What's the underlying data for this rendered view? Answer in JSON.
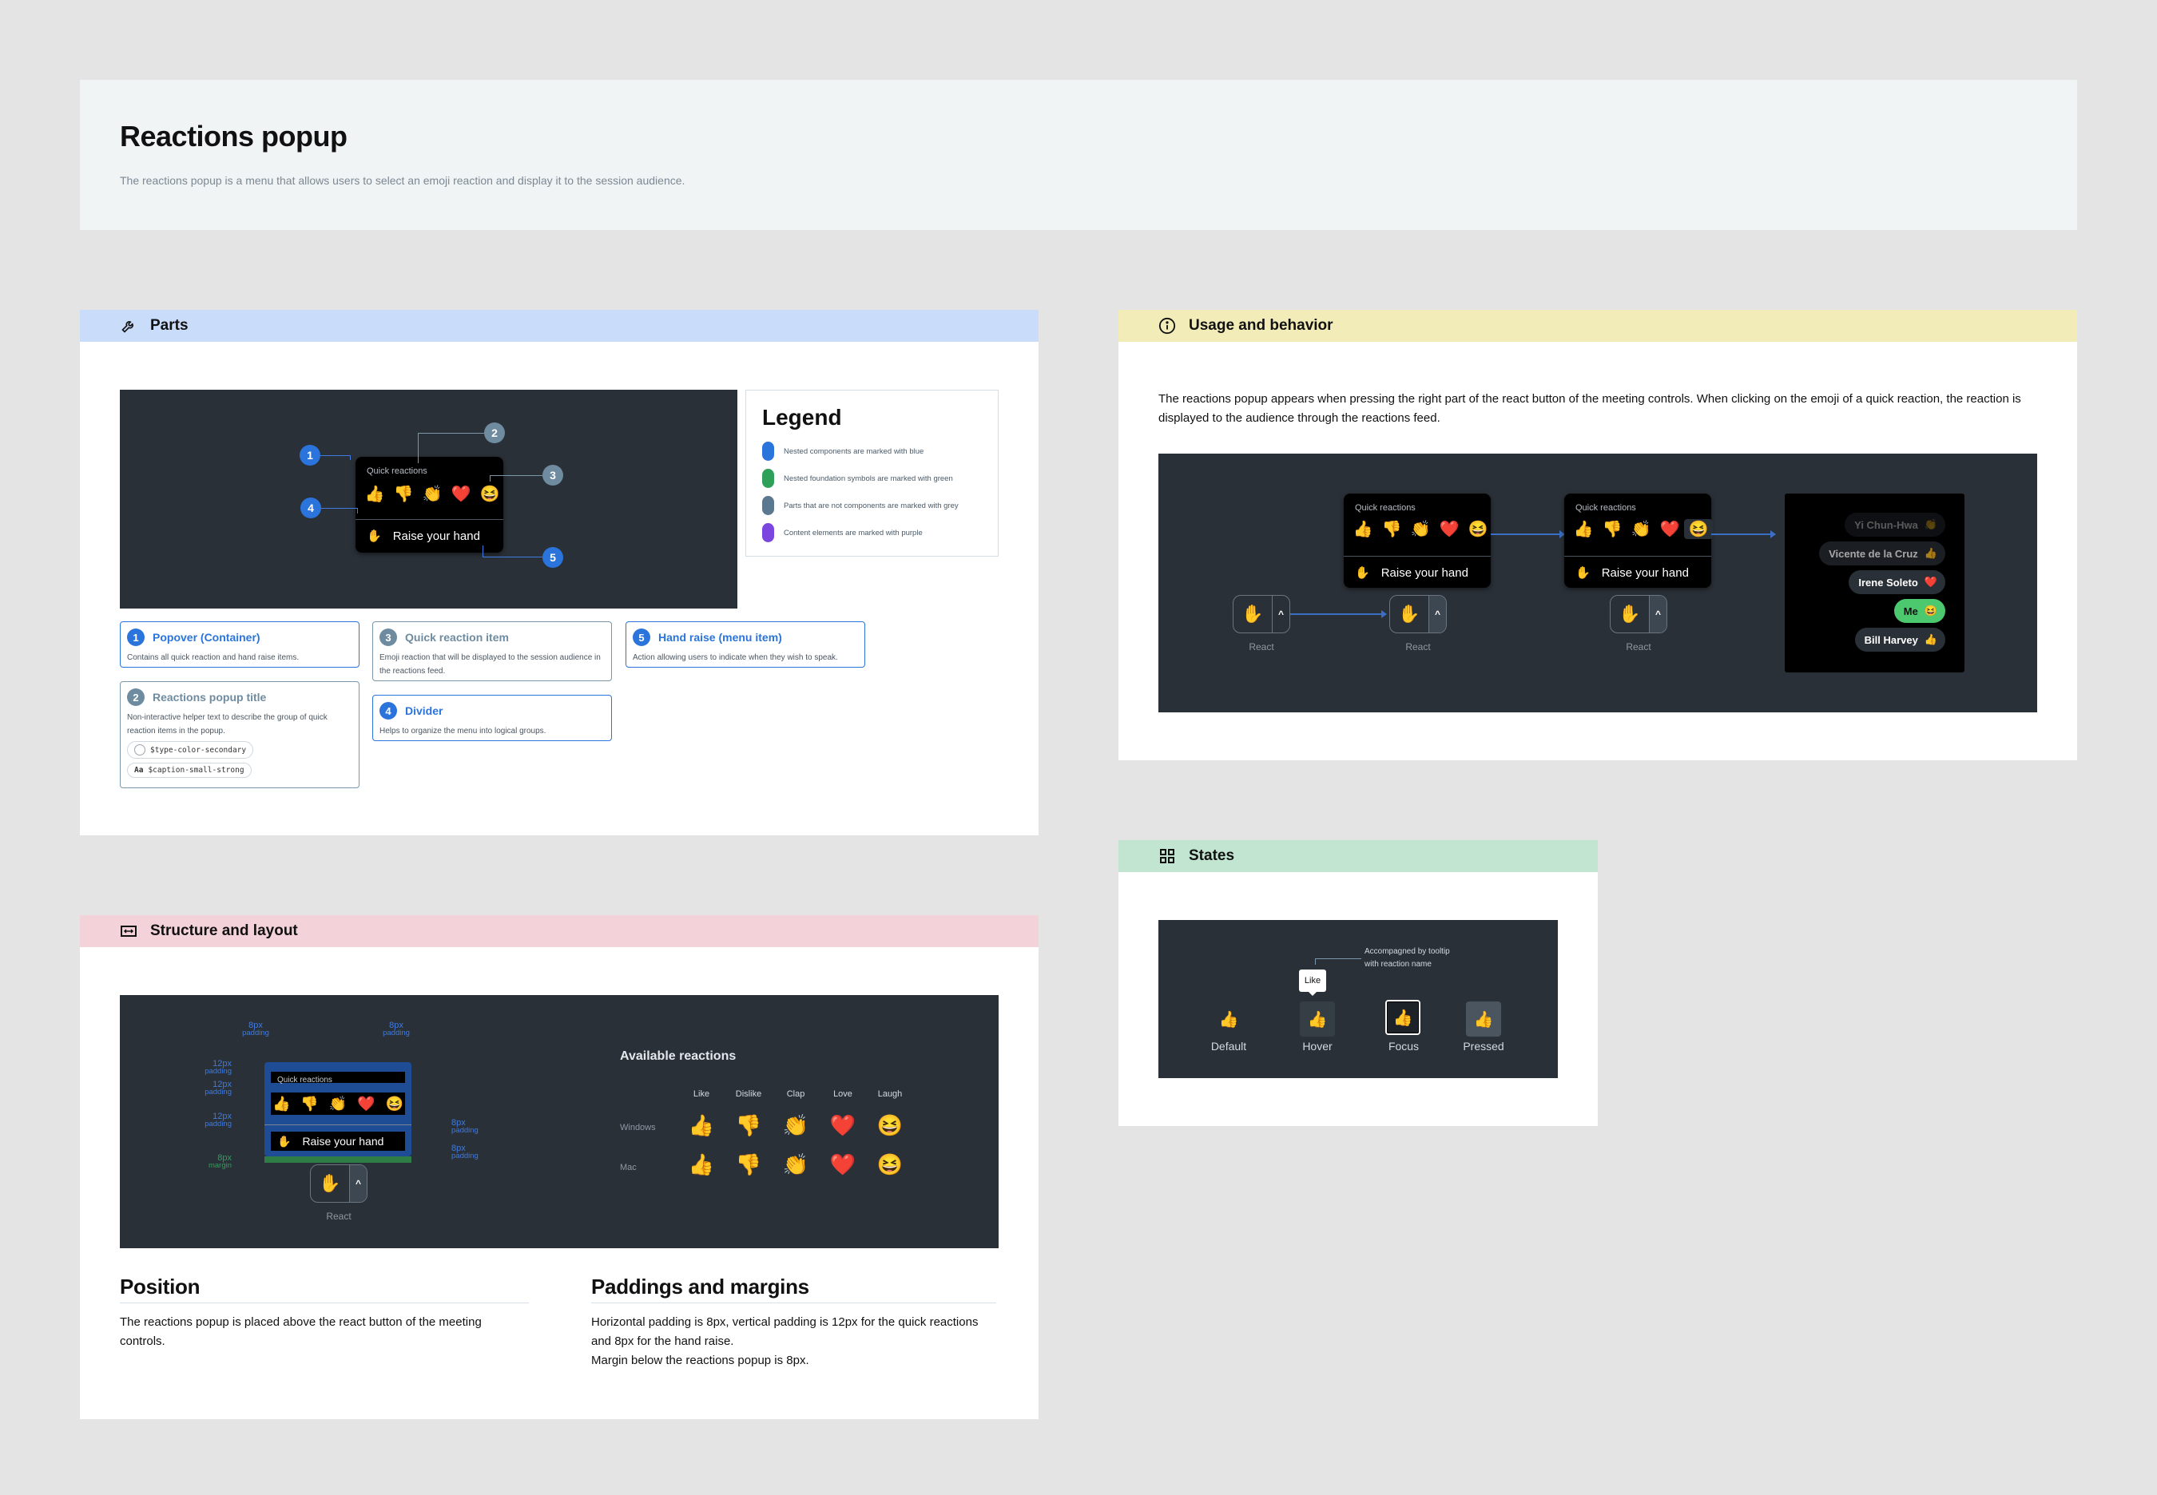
{
  "header": {
    "title": "Reactions popup",
    "subtitle": "The reactions popup is a menu that allows users to select an emoji reaction and display it to the session audience."
  },
  "parts": {
    "section_title": "Parts",
    "section_icon": "wrench-icon",
    "popup": {
      "title": "Quick reactions",
      "emojis": [
        "👍",
        "👎",
        "👏",
        "❤️",
        "😆"
      ],
      "hand_label": "Raise your hand",
      "hand_icon": "✋"
    },
    "badges": [
      "1",
      "2",
      "3",
      "4",
      "5"
    ],
    "legend": {
      "title": "Legend",
      "items": [
        {
          "label": "Nested components are marked with blue",
          "color": "#2a74dc"
        },
        {
          "label": "Nested foundation symbols are marked with green",
          "color": "#2ea05a"
        },
        {
          "label": "Parts that are not components are marked with grey",
          "color": "#5a7890"
        },
        {
          "label": "Content elements are marked with purple",
          "color": "#7b45e0"
        }
      ]
    },
    "cards": [
      {
        "num": "1",
        "title": "Popover (Container)",
        "desc": "Contains all quick reaction and hand raise items.",
        "kind": "blue"
      },
      {
        "num": "2",
        "title": "Reactions popup title",
        "desc": "Non-interactive helper text to describe the group of quick reaction items in the popup.",
        "kind": "grey",
        "tokens": [
          "$type-color-secondary",
          "$caption-small-strong"
        ],
        "token_prefix": "Aa"
      },
      {
        "num": "3",
        "title": "Quick reaction item",
        "desc": "Emoji reaction that will be displayed to the session audience in the reactions feed.",
        "kind": "grey"
      },
      {
        "num": "4",
        "title": "Divider",
        "desc": "Helps to organize the menu into logical groups.",
        "kind": "blue"
      },
      {
        "num": "5",
        "title": "Hand raise (menu item)",
        "desc": "Action allowing users to indicate when they wish to speak.",
        "kind": "blue"
      }
    ]
  },
  "usage": {
    "section_title": "Usage and behavior",
    "section_icon": "info-icon",
    "description": "The reactions popup appears when pressing the right part of the react button of the meeting controls. When clicking on the emoji of a quick reaction, the reaction is displayed to the audience through the reactions feed.",
    "react_label": "React",
    "popup_title": "Quick reactions",
    "hand_label": "Raise your hand",
    "emojis": [
      "👍",
      "👎",
      "👏",
      "❤️",
      "😆"
    ],
    "feed": [
      {
        "name": "Yi Chun-Hwa",
        "emoji": "👏",
        "faded": "strong"
      },
      {
        "name": "Vicente de la Cruz",
        "emoji": "👍",
        "faded": "light"
      },
      {
        "name": "Irene Soleto",
        "emoji": "❤️",
        "faded": "none"
      },
      {
        "name": "Me",
        "emoji": "😆",
        "faded": "none",
        "self": true
      },
      {
        "name": "Bill Harvey",
        "emoji": "👍",
        "faded": "none"
      }
    ]
  },
  "states": {
    "section_title": "States",
    "section_icon": "grid-icon",
    "annotation_line1": "Accompagned by tooltip",
    "annotation_line2": "with reaction name",
    "tooltip": "Like",
    "emoji": "👍",
    "items": [
      "Default",
      "Hover",
      "Focus",
      "Pressed"
    ]
  },
  "structure": {
    "section_title": "Structure and layout",
    "section_icon": "layout-icon",
    "markers": {
      "h_padding_value": "8px",
      "h_padding_label": "padding",
      "v_padding_value": "12px",
      "v_padding_label": "padding",
      "hand_padding_value": "8px",
      "margin_value": "8px",
      "margin_label": "margin"
    },
    "popup_title": "Quick reactions",
    "hand_label": "Raise your hand",
    "emojis": [
      "👍",
      "👎",
      "👏",
      "❤️",
      "😆"
    ],
    "react_label": "React",
    "available": {
      "title": "Available reactions",
      "columns": [
        "Like",
        "Dislike",
        "Clap",
        "Love",
        "Laugh"
      ],
      "rows": [
        {
          "label": "Windows",
          "emojis": [
            "👍",
            "👎",
            "👏",
            "❤️",
            "😆"
          ]
        },
        {
          "label": "Mac",
          "emojis": [
            "👍",
            "👎",
            "👏",
            "❤️",
            "😆"
          ]
        }
      ]
    },
    "position": {
      "title": "Position",
      "text": "The reactions popup is placed above the react button of the meeting controls."
    },
    "paddings": {
      "title": "Paddings and margins",
      "line1": "Horizontal padding is 8px, vertical padding is 12px for the quick reactions and 8px for the hand raise.",
      "line2": "Margin below the reactions popup is 8px."
    }
  }
}
